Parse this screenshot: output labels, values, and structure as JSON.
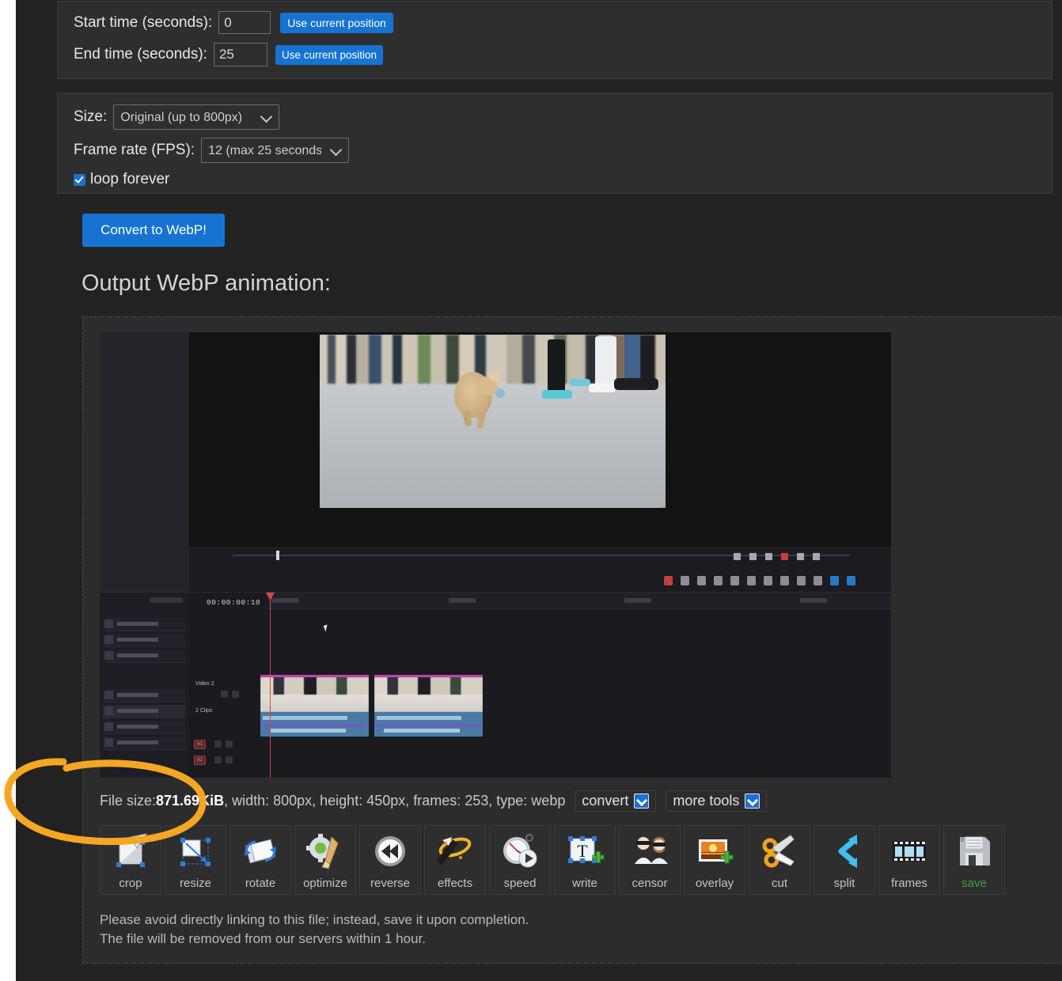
{
  "form": {
    "start_label": "Start time (seconds):",
    "start_value": "0",
    "start_button": "Use current position",
    "end_label": "End time (seconds):",
    "end_value": "25",
    "end_button": "Use current position"
  },
  "settings": {
    "size_label": "Size:",
    "size_value": "Original (up to 800px)",
    "fps_label": "Frame rate (FPS):",
    "fps_value": "12 (max 25 seconds)",
    "loop_label": "loop forever",
    "loop_checked": true
  },
  "convert_button": "Convert to WebP!",
  "output_heading": "Output WebP animation:",
  "preview": {
    "timecode": "00:00:00:10",
    "track_label": "Video 2",
    "clip_count": "2 Clips",
    "video_track_badge": "V1",
    "audio_track_badge": "A1"
  },
  "fileinfo": {
    "prefix": "File size: ",
    "size": "871.69KiB",
    "rest": ", width: 800px, height: 450px, frames: 253, type: webp",
    "convert_link": "convert",
    "more_tools_link": "more tools"
  },
  "tools": [
    {
      "label": "crop",
      "icon": "crop-icon"
    },
    {
      "label": "resize",
      "icon": "resize-icon"
    },
    {
      "label": "rotate",
      "icon": "rotate-icon"
    },
    {
      "label": "optimize",
      "icon": "optimize-icon"
    },
    {
      "label": "reverse",
      "icon": "reverse-icon"
    },
    {
      "label": "effects",
      "icon": "effects-icon"
    },
    {
      "label": "speed",
      "icon": "speed-icon"
    },
    {
      "label": "write",
      "icon": "write-icon"
    },
    {
      "label": "censor",
      "icon": "censor-icon"
    },
    {
      "label": "overlay",
      "icon": "overlay-icon"
    },
    {
      "label": "cut",
      "icon": "cut-icon"
    },
    {
      "label": "split",
      "icon": "split-icon"
    },
    {
      "label": "frames",
      "icon": "frames-icon"
    },
    {
      "label": "save",
      "icon": "save-icon"
    }
  ],
  "notes": {
    "line1": "Please avoid directly linking to this file; instead, save it upon completion.",
    "line2": "The file will be removed from our servers within 1 hour."
  },
  "colors": {
    "accent_blue": "#1673d1",
    "page_bg": "#222222",
    "panel_bg": "#2e2e2e",
    "annotation_orange": "#f5a623",
    "save_green": "#3f9f3f"
  }
}
